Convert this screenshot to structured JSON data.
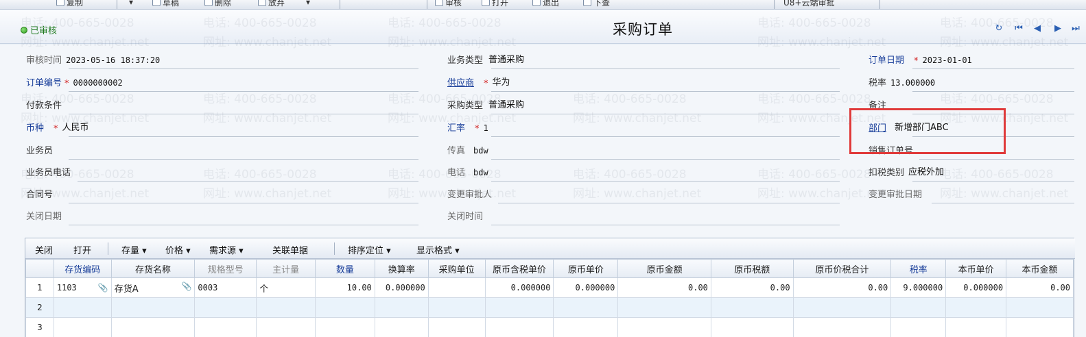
{
  "toolbar": {
    "items": [
      "复制",
      "草稿",
      "删除",
      "放弃",
      "审核",
      "打开",
      "退出",
      "下查",
      "U8+云端审批"
    ]
  },
  "header": {
    "status": "已审核",
    "title": "采购订单"
  },
  "watermark": {
    "phone": "电话: 400-665-0028",
    "site": "网址: www.chanjet.net"
  },
  "form": {
    "audit_time": {
      "label": "审核时间",
      "value": "2023-05-16 18:37:20"
    },
    "order_no": {
      "label": "订单编号",
      "value": "0000000002"
    },
    "payment_terms": {
      "label": "付款条件",
      "value": ""
    },
    "currency": {
      "label": "币种",
      "value": "人民币"
    },
    "salesman": {
      "label": "业务员",
      "value": ""
    },
    "salesman_phone": {
      "label": "业务员电话",
      "value": ""
    },
    "contract_no": {
      "label": "合同号",
      "value": ""
    },
    "close_date": {
      "label": "关闭日期",
      "value": ""
    },
    "business_type": {
      "label": "业务类型",
      "value": "普通采购"
    },
    "supplier": {
      "label": "供应商",
      "value": "华为"
    },
    "purchase_type": {
      "label": "采购类型",
      "value": "普通采购"
    },
    "exchange_rate": {
      "label": "汇率",
      "value": "1"
    },
    "fax": {
      "label": "传真",
      "value": "bdw"
    },
    "phone": {
      "label": "电话",
      "value": "bdw"
    },
    "change_approver": {
      "label": "变更审批人",
      "value": ""
    },
    "close_time": {
      "label": "关闭时间",
      "value": ""
    },
    "order_date": {
      "label": "订单日期",
      "value": "2023-01-01"
    },
    "tax_rate": {
      "label": "税率",
      "value": "13.000000"
    },
    "remark": {
      "label": "备注",
      "value": ""
    },
    "department": {
      "label": "部门",
      "value": "新增部门ABC"
    },
    "sales_order_no": {
      "label": "销售订单号",
      "value": ""
    },
    "deduct_tax_type": {
      "label": "扣税类别",
      "value": "应税外加"
    },
    "change_approve_date": {
      "label": "变更审批日期",
      "value": ""
    },
    "required_mark": "*"
  },
  "grid_toolbar": {
    "close": "关闭",
    "open": "打开",
    "stock": "存量",
    "price": "价格",
    "demand_source": "需求源",
    "linked_docs": "关联单据",
    "sort_locate": "排序定位",
    "display_format": "显示格式"
  },
  "grid": {
    "columns": [
      "存货编码",
      "存货名称",
      "规格型号",
      "主计量",
      "数量",
      "换算率",
      "采购单位",
      "原币含税单价",
      "原币单价",
      "原币金额",
      "原币税额",
      "原币价税合计",
      "税率",
      "本币单价",
      "本币金额"
    ],
    "rows": [
      {
        "no": "1",
        "cells": [
          "1103",
          "存货A",
          "0003",
          "个",
          "10.00",
          "0.000000",
          "",
          "0.000000",
          "0.000000",
          "0.00",
          "0.00",
          "0.00",
          "9.000000",
          "0.000000",
          "0.00"
        ]
      },
      {
        "no": "2",
        "cells": [
          "",
          "",
          "",
          "",
          "",
          "",
          "",
          "",
          "",
          "",
          "",
          "",
          "",
          "",
          ""
        ]
      },
      {
        "no": "3",
        "cells": [
          "",
          "",
          "",
          "",
          "",
          "",
          "",
          "",
          "",
          "",
          "",
          "",
          "",
          "",
          ""
        ]
      }
    ]
  },
  "colors": {
    "link": "#1a3f9a",
    "required": "#d32020",
    "highlight": "#e03a3a",
    "status": "#1f7a1f"
  }
}
